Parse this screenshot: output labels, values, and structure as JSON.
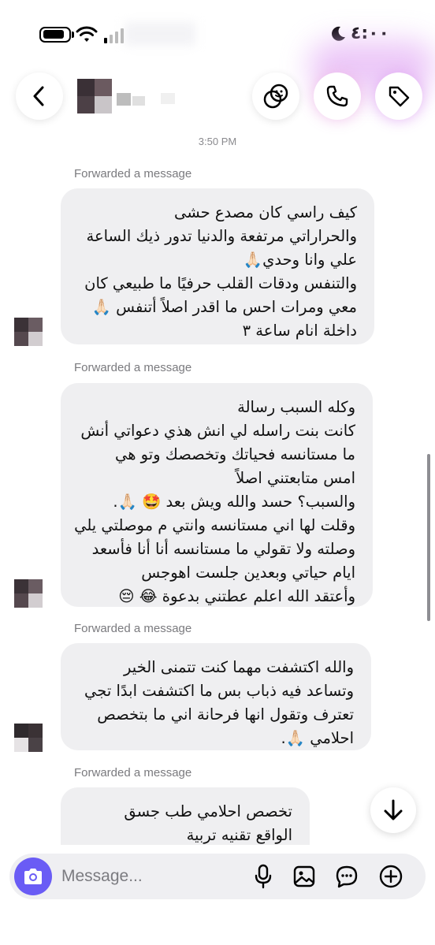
{
  "status_bar": {
    "time": "٤:٠٠"
  },
  "chat": {
    "timestamp": "3:50 PM",
    "messages": [
      {
        "forwarded_label": "Forwarded a message",
        "lines": [
          "كيف راسي كان مصدع حشى",
          "والحراراتي مرتفعة والدنيا تدور ذيك الساعة",
          "علي وانا وحدي🙏🏻",
          "والتنفس ودقات القلب حرفيًا ما طبيعي كان",
          "معي ومرات احس ما اقدر اصلاً أتنفس 🙏🏻",
          "داخلة انام ساعة ٣"
        ]
      },
      {
        "forwarded_label": "Forwarded a message",
        "lines": [
          "وكله السبب رسالة",
          "كانت بنت راسله لي انش هذي دعواتي أنش",
          "ما مستانسه فحياتك وتخصصك وتو هي",
          "امس متابعتني اصلاً",
          "والسبب؟ حسد والله ويش بعد 🤩 🙏🏻.",
          "وقلت لها اني مستانسه وانتي م موصلتي يلي",
          "وصلته ولا تقولي ما مستانسه أنا أنا فأسعد",
          "ايام حياتي وبعدين جلست اهوجس",
          "وأعتقد الله اعلم عطتني بدعوة 😂 😔"
        ]
      },
      {
        "forwarded_label": "Forwarded a message",
        "lines": [
          "والله اكتشفت مهما كنت تتمنى الخير",
          "وتساعد فيه ذباب بس ما اكتشفت ابدًا تجي",
          "تعترف وتقول انها فرحانة اني ما بتخصص",
          "احلامي 🙏🏻."
        ]
      },
      {
        "forwarded_label": "Forwarded a message",
        "lines": [
          "تخصص احلامي طب جسق",
          "الواقع تقنيه تربية"
        ]
      }
    ]
  },
  "composer": {
    "placeholder": "Message..."
  },
  "icons": {
    "back": "chevron-left-icon",
    "effects": "sticker-effects-icon",
    "call": "phone-icon",
    "tag": "tag-icon",
    "camera": "camera-icon",
    "mic": "microphone-icon",
    "gallery": "image-icon",
    "chat": "chat-bubble-icon",
    "add": "plus-circle-icon",
    "scroll_down": "arrow-down-icon"
  },
  "colors": {
    "bubble": "#efeff1",
    "camera_button": "#6a5cf5",
    "glow": "#e7b9f6"
  }
}
